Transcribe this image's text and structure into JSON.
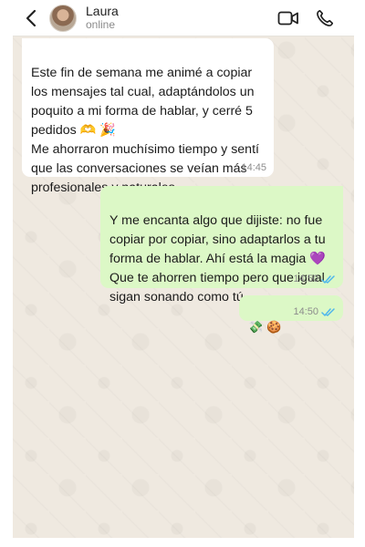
{
  "header": {
    "contact_name": "Laura",
    "contact_status": "online"
  },
  "messages": [
    {
      "direction": "incoming",
      "text": "Este fin de semana me animé a copiar los mensajes tal cual, adaptándolos un poquito a mi forma de hablar, y cerré 5 pedidos 🫶 🎉\nMe ahorraron muchísimo tiempo y sentí que las conversaciones se veían más profesionales y naturales.",
      "time": "14:45"
    },
    {
      "direction": "outgoing",
      "text": "Y me encanta algo que dijiste: no fue copiar por copiar, sino adaptarlos a tu forma de hablar. Ahí está la magia 💜\nQue te ahorren tiempo pero que igual sigan sonando como tú.",
      "time": "14:50",
      "read": true
    },
    {
      "direction": "outgoing",
      "text": "💸 🍪",
      "time": "14:50",
      "read": true
    }
  ],
  "colors": {
    "incoming_bubble": "#ffffff",
    "outgoing_bubble": "#dcf8c6",
    "read_ticks": "#4fb6ec",
    "chat_background": "#efe9e0"
  },
  "icons": {
    "back": "chevron-left-icon",
    "video": "video-camera-icon",
    "call": "phone-icon",
    "read_receipt": "double-check-icon"
  }
}
